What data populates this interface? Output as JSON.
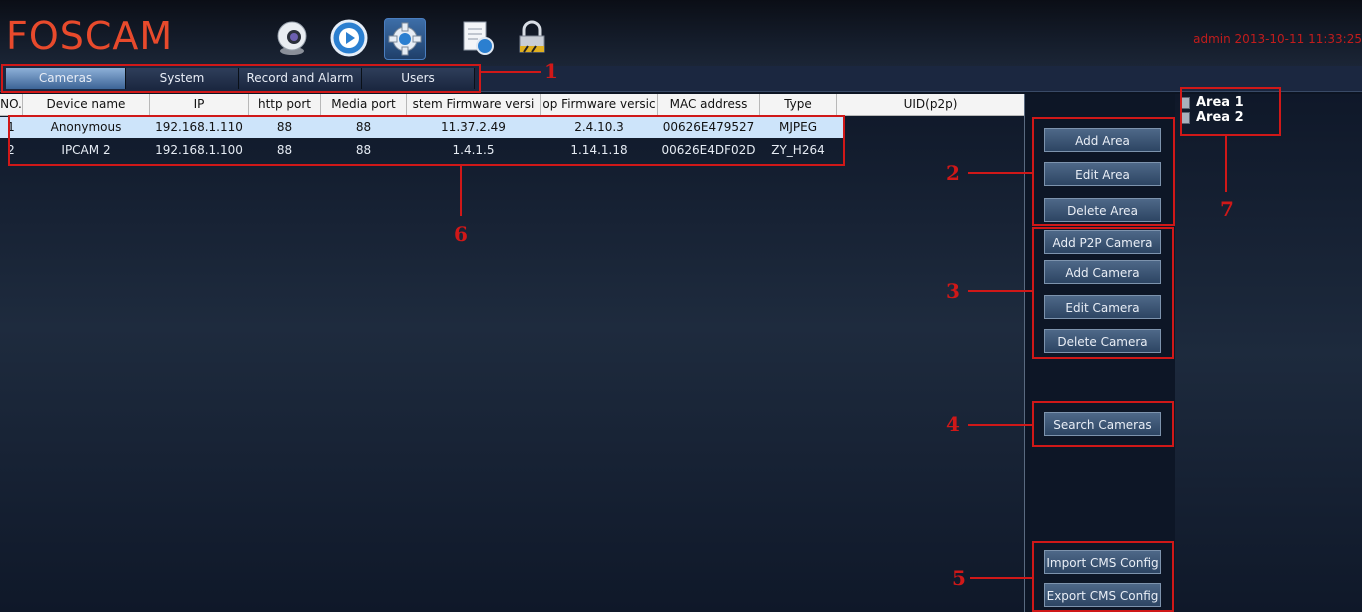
{
  "header": {
    "logo": "FOSCAM",
    "user": "admin",
    "datetime": "2013-10-11  11:33:25",
    "nav_icons": [
      "webcam-icon",
      "playback-icon",
      "settings-gear-icon",
      "log-document-icon",
      "lock-icon"
    ]
  },
  "tabs": [
    {
      "label": "Cameras",
      "active": true
    },
    {
      "label": "System",
      "active": false
    },
    {
      "label": "Record and Alarm",
      "active": false
    },
    {
      "label": "Users",
      "active": false
    }
  ],
  "table": {
    "headers": [
      "NO.",
      "Device name",
      "IP",
      "http port",
      "Media port",
      "stem Firmware versi",
      "op Firmware versic",
      "MAC address",
      "Type",
      "UID(p2p)"
    ],
    "rows": [
      {
        "no": "1",
        "name": "Anonymous",
        "ip": "192.168.1.110",
        "http": "88",
        "media": "88",
        "sysfw": "11.37.2.49",
        "appfw": "2.4.10.3",
        "mac": "00626E479527",
        "type": "MJPEG",
        "uid": ""
      },
      {
        "no": "2",
        "name": "IPCAM 2",
        "ip": "192.168.1.100",
        "http": "88",
        "media": "88",
        "sysfw": "1.4.1.5",
        "appfw": "1.14.1.18",
        "mac": "00626E4DF02D",
        "type": "ZY_H264",
        "uid": ""
      }
    ]
  },
  "buttons": {
    "add_area": "Add Area",
    "edit_area": "Edit Area",
    "delete_area": "Delete Area",
    "add_p2p": "Add P2P Camera",
    "add_camera": "Add Camera",
    "edit_camera": "Edit Camera",
    "delete_camera": "Delete Camera",
    "search_cameras": "Search Cameras",
    "import_cms": "Import CMS Config",
    "export_cms": "Export CMS Config"
  },
  "areas": [
    "Area 1",
    "Area 2"
  ],
  "callouts": [
    "1",
    "2",
    "3",
    "4",
    "5",
    "6",
    "7"
  ],
  "colors": {
    "accent_red": "#d01818",
    "logo": "#e84a2c",
    "selected_row": "#cde4fa",
    "button": "#3d5676"
  }
}
